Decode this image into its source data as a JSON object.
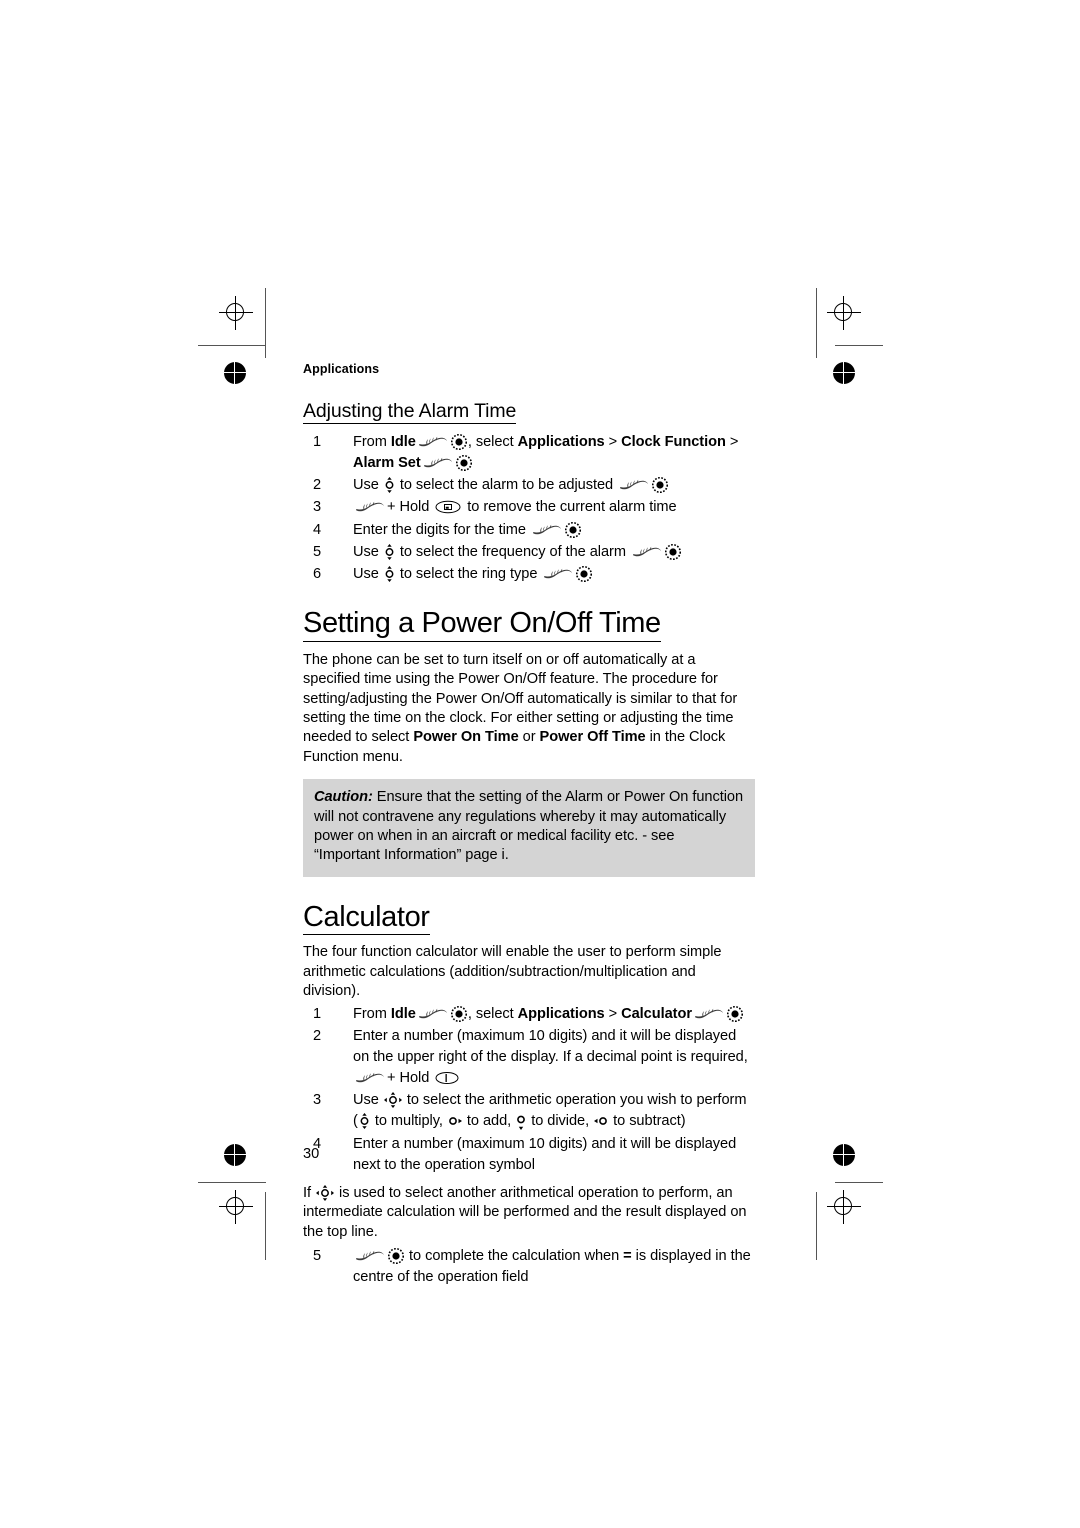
{
  "document": {
    "running_head": "Applications",
    "page_number": "30"
  },
  "alarm_section": {
    "heading": "Adjusting the Alarm Time",
    "steps": [
      {
        "num": "1",
        "parts": [
          {
            "t": "text",
            "v": "From "
          },
          {
            "t": "bold",
            "v": "Idle"
          },
          {
            "t": "icon",
            "v": "softkey-hand-icon"
          },
          {
            "t": "icon",
            "v": "select-button-icon"
          },
          {
            "t": "text",
            "v": ", select "
          },
          {
            "t": "bold",
            "v": "Applications"
          },
          {
            "t": "text",
            "v": " > "
          },
          {
            "t": "bold",
            "v": "Clock Function"
          },
          {
            "t": "text",
            "v": " > "
          },
          {
            "t": "bold",
            "v": "Alarm Set"
          },
          {
            "t": "icon",
            "v": "softkey-hand-icon"
          },
          {
            "t": "icon",
            "v": "select-button-icon"
          }
        ]
      },
      {
        "num": "2",
        "parts": [
          {
            "t": "text",
            "v": "Use "
          },
          {
            "t": "icon",
            "v": "nav-updown-icon"
          },
          {
            "t": "text",
            "v": " to select the alarm to be adjusted "
          },
          {
            "t": "icon",
            "v": "softkey-hand-icon"
          },
          {
            "t": "icon",
            "v": "select-button-icon"
          }
        ]
      },
      {
        "num": "3",
        "parts": [
          {
            "t": "icon",
            "v": "softkey-hand-icon"
          },
          {
            "t": "text",
            "v": "+ Hold "
          },
          {
            "t": "icon",
            "v": "clear-key-icon"
          },
          {
            "t": "text",
            "v": " to remove the current alarm time"
          }
        ]
      },
      {
        "num": "4",
        "parts": [
          {
            "t": "text",
            "v": "Enter the digits for the time "
          },
          {
            "t": "icon",
            "v": "softkey-hand-icon"
          },
          {
            "t": "icon",
            "v": "select-button-icon"
          }
        ]
      },
      {
        "num": "5",
        "parts": [
          {
            "t": "text",
            "v": "Use "
          },
          {
            "t": "icon",
            "v": "nav-updown-icon"
          },
          {
            "t": "text",
            "v": " to select the frequency of the alarm "
          },
          {
            "t": "icon",
            "v": "softkey-hand-icon"
          },
          {
            "t": "icon",
            "v": "select-button-icon"
          }
        ]
      },
      {
        "num": "6",
        "parts": [
          {
            "t": "text",
            "v": "Use "
          },
          {
            "t": "icon",
            "v": "nav-updown-icon"
          },
          {
            "t": "text",
            "v": " to select the ring type "
          },
          {
            "t": "icon",
            "v": "softkey-hand-icon"
          },
          {
            "t": "icon",
            "v": "select-button-icon"
          }
        ]
      }
    ]
  },
  "power_section": {
    "heading": "Setting a Power On/Off Time",
    "body_parts": [
      {
        "t": "text",
        "v": "The phone can be set to turn itself on or off automatically at a specified time using the Power On/Off feature. The procedure for setting/adjusting the Power On/Off automatically is similar to that for setting the time on the clock. For either setting or adjusting the time  needed to select "
      },
      {
        "t": "bold",
        "v": "Power On Time"
      },
      {
        "t": "text",
        "v": " or "
      },
      {
        "t": "bold",
        "v": "Power Off Time"
      },
      {
        "t": "text",
        "v": " in the Clock Function menu."
      }
    ],
    "caution": {
      "lead": "Caution:",
      "text": " Ensure that the setting of the Alarm or Power On function will not contravene any regulations whereby it may automatically power on when in an aircraft or medical facility etc. - see “Important Information” page i."
    }
  },
  "calculator_section": {
    "heading": "Calculator",
    "intro": "The four function calculator will enable the user to perform simple arithmetic calculations (addition/subtraction/multiplication and division).",
    "steps": [
      {
        "num": "1",
        "parts": [
          {
            "t": "text",
            "v": "From "
          },
          {
            "t": "bold",
            "v": "Idle"
          },
          {
            "t": "icon",
            "v": "softkey-hand-icon"
          },
          {
            "t": "icon",
            "v": "select-button-icon"
          },
          {
            "t": "text",
            "v": ", select "
          },
          {
            "t": "bold",
            "v": "Applications"
          },
          {
            "t": "text",
            "v": " > "
          },
          {
            "t": "bold",
            "v": "Calculator"
          },
          {
            "t": "icon",
            "v": "softkey-hand-icon"
          },
          {
            "t": "icon",
            "v": "select-button-icon"
          }
        ]
      },
      {
        "num": "2",
        "parts": [
          {
            "t": "text",
            "v": "Enter a number (maximum 10 digits) and it will be displayed on the upper right of the display. If a decimal point is required, "
          },
          {
            "t": "icon",
            "v": "softkey-hand-icon"
          },
          {
            "t": "text",
            "v": "+ Hold "
          },
          {
            "t": "icon",
            "v": "key-1-icon"
          }
        ]
      },
      {
        "num": "3",
        "parts": [
          {
            "t": "text",
            "v": "Use "
          },
          {
            "t": "icon",
            "v": "nav-fourway-icon"
          },
          {
            "t": "text",
            "v": " to select the arithmetic operation you wish to perform ("
          },
          {
            "t": "icon",
            "v": "nav-updown-icon"
          },
          {
            "t": "text",
            "v": " to multiply, "
          },
          {
            "t": "icon",
            "v": "nav-right-icon"
          },
          {
            "t": "text",
            "v": " to add, "
          },
          {
            "t": "icon",
            "v": "nav-down-icon"
          },
          {
            "t": "text",
            "v": " to divide, "
          },
          {
            "t": "icon",
            "v": "nav-left-icon"
          },
          {
            "t": "text",
            "v": " to subtract)"
          }
        ]
      },
      {
        "num": "4",
        "parts": [
          {
            "t": "text",
            "v": "Enter a number (maximum 10 digits) and it will be displayed next to the operation symbol"
          }
        ]
      }
    ],
    "note_parts": [
      {
        "t": "text",
        "v": "If "
      },
      {
        "t": "icon",
        "v": "nav-fourway-icon"
      },
      {
        "t": "text",
        "v": " is used to select another arithmetical operation to perform, an intermediate calculation will be performed and the result displayed on the top line."
      }
    ],
    "final_step": {
      "num": "5",
      "parts": [
        {
          "t": "icon",
          "v": "softkey-hand-icon"
        },
        {
          "t": "icon",
          "v": "select-button-icon"
        },
        {
          "t": "text",
          "v": " to complete the calculation when "
        },
        {
          "t": "eq",
          "v": "="
        },
        {
          "t": "text",
          "v": " is displayed in the centre of the operation field"
        }
      ]
    }
  },
  "print_marks": {
    "caution_background": "#d4d4d4",
    "mark_color": "#000000",
    "crop_line_color": "#555555"
  }
}
